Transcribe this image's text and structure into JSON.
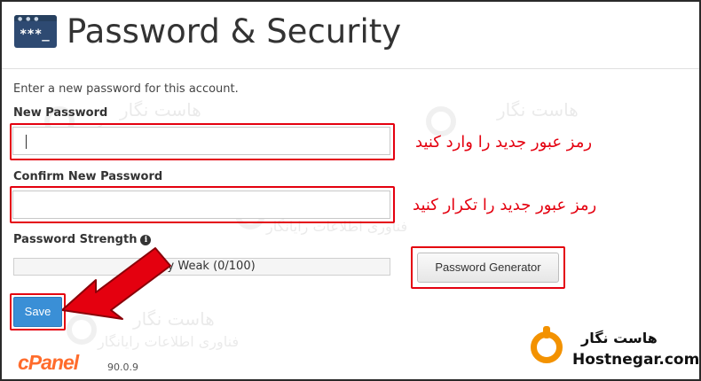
{
  "header": {
    "title": "Password & Security",
    "icon": "terminal-password-icon"
  },
  "form": {
    "intro": "Enter a new password for this account.",
    "new_password_label": "New Password",
    "new_password_value": "",
    "confirm_password_label": "Confirm New Password",
    "confirm_password_value": "",
    "strength_label": "Password Strength",
    "strength_value": 0,
    "strength_text": "Very Weak (0/100)",
    "generator_label": "Password Generator",
    "save_label": "Save"
  },
  "annotations": {
    "new_password_note": "رمز عبور جدید را وارد کنید",
    "confirm_password_note": "رمز عبور جدید را تکرار کنید"
  },
  "watermark": {
    "fa_name": "هاست نگار",
    "fa_tagline": "فناوری اطلاعات رایانگار"
  },
  "footer": {
    "logo": "cPanel",
    "version": "90.0.9"
  },
  "branding": {
    "fa_name": "هاست نگار",
    "en_name": "Hostnegar.com"
  },
  "colors": {
    "accent_red": "#e4000f",
    "save_blue": "#3a8fd6",
    "brand_orange": "#f39200",
    "cpanel_orange": "#ff6c2c"
  }
}
